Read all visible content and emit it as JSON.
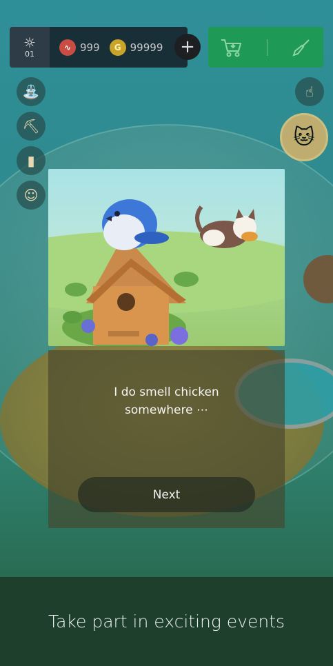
{
  "hud": {
    "day_label": "01",
    "hearts": "999",
    "coins": "99999",
    "coin_glyph": "G",
    "plus_label": "+"
  },
  "dialog": {
    "message": "I do smell chicken\nsomewhere ⋯",
    "next_label": "Next"
  },
  "banner": {
    "text": "Take part in exciting events"
  },
  "icons": {
    "left_side": [
      "watering-can-icon",
      "pickaxe-icon",
      "book-icon",
      "cat-icon"
    ],
    "right_side": [
      "tap-hand-icon",
      "cat-avatar-icon"
    ],
    "shop": [
      "cart-icon",
      "trowel-icon"
    ]
  },
  "colors": {
    "shop_green": "#1f9a56",
    "banner_bg": "#1e3f2c"
  }
}
